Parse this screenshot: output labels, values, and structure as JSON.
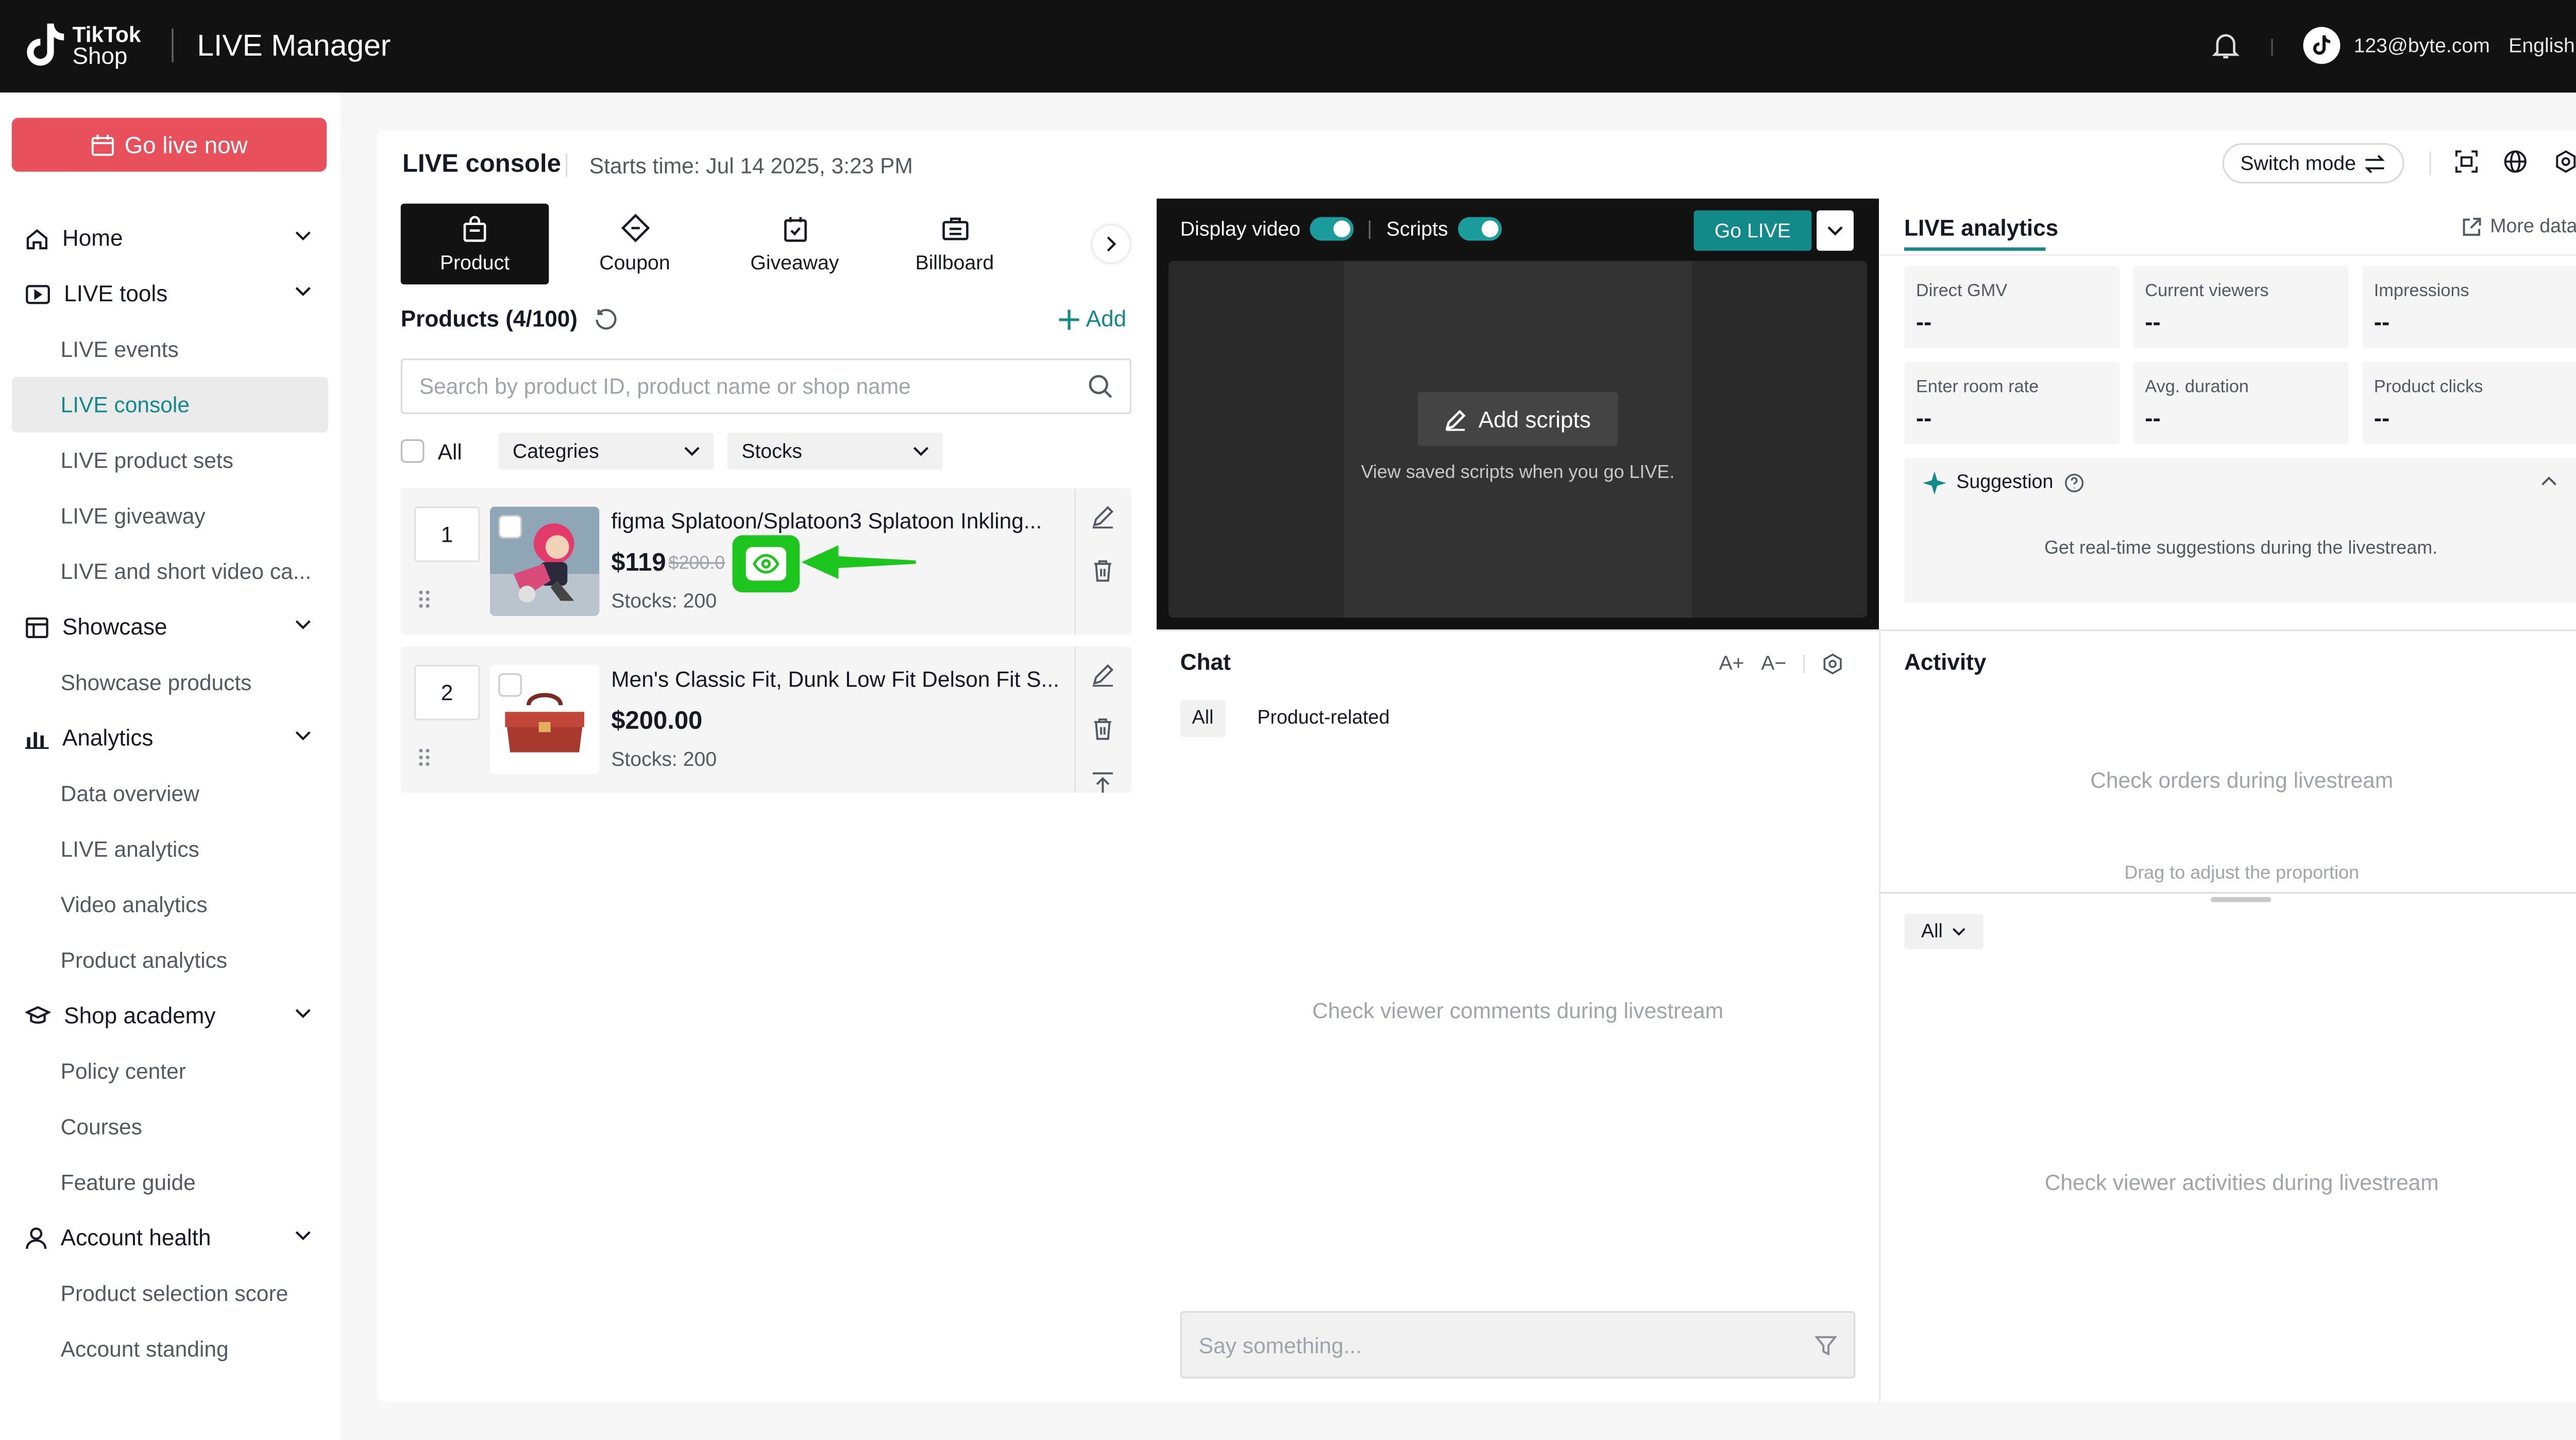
{
  "topbar": {
    "logo_line1": "TikTok",
    "logo_line2": "Shop",
    "app_title": "LIVE Manager",
    "email": "123@byte.com",
    "language": "English"
  },
  "sidebar": {
    "go_live_label": "Go live now",
    "nav": {
      "home": "Home",
      "live_tools": "LIVE tools",
      "live_events": "LIVE events",
      "live_console": "LIVE console",
      "live_product_sets": "LIVE product sets",
      "live_giveaway": "LIVE giveaway",
      "live_short_video": "LIVE and short video ca...",
      "showcase": "Showcase",
      "showcase_products": "Showcase products",
      "analytics": "Analytics",
      "data_overview": "Data overview",
      "live_analytics": "LIVE analytics",
      "video_analytics": "Video analytics",
      "product_analytics": "Product analytics",
      "shop_academy": "Shop academy",
      "policy_center": "Policy center",
      "courses": "Courses",
      "feature_guide": "Feature guide",
      "account_health": "Account health",
      "product_selection_score": "Product selection score",
      "account_standing": "Account standing"
    }
  },
  "console": {
    "title": "LIVE console",
    "starts_time": "Starts time: Jul 14 2025, 3:23 PM",
    "switch_mode": "Switch mode"
  },
  "tabs": {
    "product": "Product",
    "coupon": "Coupon",
    "giveaway": "Giveaway",
    "billboard": "Billboard"
  },
  "products": {
    "heading": "Products (4/100)",
    "add_label": "Add",
    "search_placeholder": "Search by product ID, product name or shop name",
    "all_label": "All",
    "categories_label": "Categries",
    "stocks_label": "Stocks",
    "items": [
      {
        "rank": "1",
        "name": "figma Splatoon/Splatoon3 Splatoon Inkling...",
        "price": "$119",
        "original_price": "$200.0",
        "stocks": "Stocks: 200"
      },
      {
        "rank": "2",
        "name": "Men's Classic Fit, Dunk Low Fit Delson Fit S...",
        "price": "$200.00",
        "stocks": "Stocks: 200"
      }
    ]
  },
  "video": {
    "display_video": "Display video",
    "scripts": "Scripts",
    "go_live": "Go LIVE",
    "add_scripts": "Add scripts",
    "view_saved": "View saved scripts when you go LIVE."
  },
  "chat": {
    "title": "Chat",
    "font_up": "A+",
    "font_down": "A−",
    "tab_all": "All",
    "tab_product": "Product-related",
    "empty": "Check viewer comments during livestream",
    "placeholder": "Say something..."
  },
  "analytics": {
    "title": "LIVE analytics",
    "more_data": "More data",
    "metrics": [
      {
        "label": "Direct GMV",
        "value": "--"
      },
      {
        "label": "Current viewers",
        "value": "--"
      },
      {
        "label": "Impressions",
        "value": "--"
      },
      {
        "label": "Enter room rate",
        "value": "--"
      },
      {
        "label": "Avg. duration",
        "value": "--"
      },
      {
        "label": "Product clicks",
        "value": "--"
      }
    ],
    "suggestion_title": "Suggestion",
    "suggestion_body": "Get real-time suggestions during the livestream."
  },
  "activity": {
    "title": "Activity",
    "orders_empty": "Check orders during livestream",
    "drag_hint": "Drag to adjust the proportion",
    "filter_all": "All",
    "empty": "Check viewer activities during livestream"
  },
  "colors": {
    "accent": "#128a8a",
    "go_live_red": "#e8505b",
    "highlight_green": "#1fc51f"
  }
}
